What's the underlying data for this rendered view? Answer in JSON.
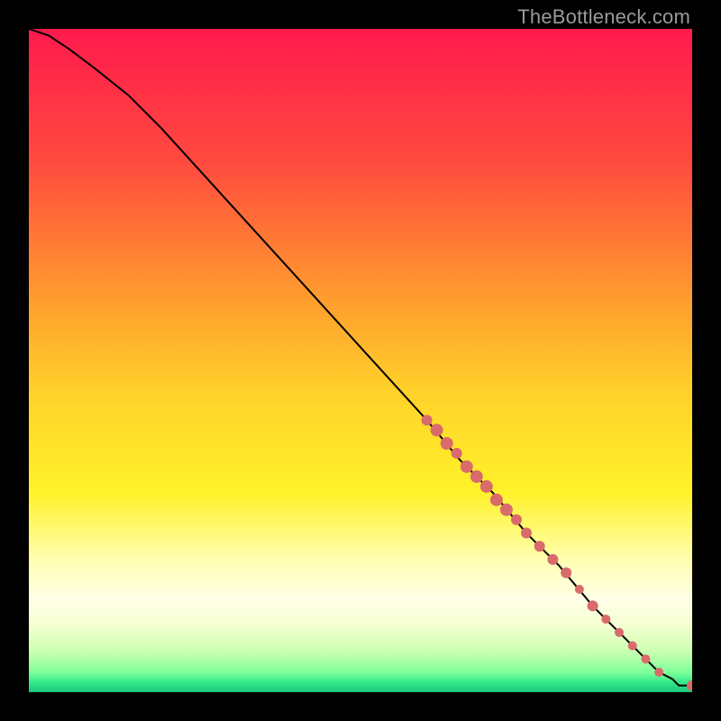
{
  "attribution": "TheBottleneck.com",
  "gradient": {
    "stops": [
      {
        "offset": 0,
        "color": "#ff1a4d"
      },
      {
        "offset": 0.2,
        "color": "#ff4a3f"
      },
      {
        "offset": 0.4,
        "color": "#ff9a2e"
      },
      {
        "offset": 0.55,
        "color": "#ffd22a"
      },
      {
        "offset": 0.7,
        "color": "#fff22a"
      },
      {
        "offset": 0.8,
        "color": "#ffffb0"
      },
      {
        "offset": 0.86,
        "color": "#ffffe8"
      },
      {
        "offset": 0.9,
        "color": "#f4ffd0"
      },
      {
        "offset": 0.94,
        "color": "#c8ffb0"
      },
      {
        "offset": 0.97,
        "color": "#7dff9a"
      },
      {
        "offset": 0.985,
        "color": "#35e98a"
      },
      {
        "offset": 1.0,
        "color": "#18c77a"
      }
    ]
  },
  "chart_data": {
    "type": "line",
    "title": "",
    "xlabel": "",
    "ylabel": "",
    "xlim": [
      0,
      100
    ],
    "ylim": [
      0,
      100
    ],
    "series": [
      {
        "name": "curve",
        "x": [
          0,
          3,
          6,
          10,
          15,
          20,
          30,
          40,
          50,
          60,
          65,
          70,
          75,
          80,
          85,
          90,
          93,
          95,
          97,
          98,
          100
        ],
        "y": [
          100,
          99,
          97,
          94,
          90,
          85,
          74,
          63,
          52,
          41,
          35,
          30,
          24,
          19,
          13,
          8,
          5,
          3,
          2,
          1,
          1
        ]
      }
    ],
    "markers": {
      "name": "dots",
      "color": "#d96b6b",
      "points": [
        {
          "x": 60.0,
          "y": 41.0,
          "r": 6
        },
        {
          "x": 61.5,
          "y": 39.5,
          "r": 7
        },
        {
          "x": 63.0,
          "y": 37.5,
          "r": 7
        },
        {
          "x": 64.5,
          "y": 36.0,
          "r": 6
        },
        {
          "x": 66.0,
          "y": 34.0,
          "r": 7
        },
        {
          "x": 67.5,
          "y": 32.5,
          "r": 7
        },
        {
          "x": 69.0,
          "y": 31.0,
          "r": 7
        },
        {
          "x": 70.5,
          "y": 29.0,
          "r": 7
        },
        {
          "x": 72.0,
          "y": 27.5,
          "r": 7
        },
        {
          "x": 73.5,
          "y": 26.0,
          "r": 6
        },
        {
          "x": 75.0,
          "y": 24.0,
          "r": 6
        },
        {
          "x": 77.0,
          "y": 22.0,
          "r": 6
        },
        {
          "x": 79.0,
          "y": 20.0,
          "r": 6
        },
        {
          "x": 81.0,
          "y": 18.0,
          "r": 6
        },
        {
          "x": 83.0,
          "y": 15.5,
          "r": 5
        },
        {
          "x": 85.0,
          "y": 13.0,
          "r": 6
        },
        {
          "x": 87.0,
          "y": 11.0,
          "r": 5
        },
        {
          "x": 89.0,
          "y": 9.0,
          "r": 5
        },
        {
          "x": 91.0,
          "y": 7.0,
          "r": 5
        },
        {
          "x": 93.0,
          "y": 5.0,
          "r": 5
        },
        {
          "x": 95.0,
          "y": 3.0,
          "r": 5
        },
        {
          "x": 100.0,
          "y": 1.0,
          "r": 6
        }
      ]
    }
  }
}
